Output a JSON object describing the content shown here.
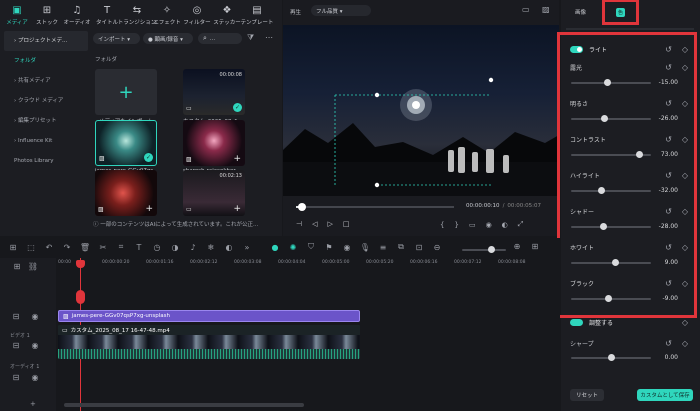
{
  "toolbar": {
    "items": [
      {
        "label": "メディア",
        "icon": "media-icon",
        "glyph": "▣"
      },
      {
        "label": "ストック",
        "icon": "stock-icon",
        "glyph": "⊞"
      },
      {
        "label": "オーディオ",
        "icon": "music-icon",
        "glyph": "♫"
      },
      {
        "label": "タイトル",
        "icon": "title-icon",
        "glyph": "T"
      },
      {
        "label": "トランジション",
        "icon": "transition-icon",
        "glyph": "⇆"
      },
      {
        "label": "エフェクト",
        "icon": "effect-icon",
        "glyph": "✧"
      },
      {
        "label": "フィルター",
        "icon": "filter-icon",
        "glyph": "◎"
      },
      {
        "label": "ステッカー",
        "icon": "sticker-icon",
        "glyph": "❖"
      },
      {
        "label": "テンプレート",
        "icon": "template-icon",
        "glyph": "▤"
      }
    ]
  },
  "sidebar": {
    "items": [
      {
        "label": "› プロジェクトメデ..."
      },
      {
        "label": "フォルダ"
      },
      {
        "label": "› 共有メディア"
      },
      {
        "label": "› クラウド メディア"
      },
      {
        "label": "› 編集プリセット"
      },
      {
        "label": "› Influence Kit"
      },
      {
        "label": "Photos Library"
      }
    ]
  },
  "media": {
    "import_label": "インポート ▾",
    "filter_label": "● 顕画/録音 ▾",
    "search_placeholder": "...",
    "folder_label": "フォルダ",
    "import_tile_label": "メディアをインポート",
    "items": [
      {
        "name": "カスタム_2025_08_1...",
        "duration": "00:00:08"
      },
      {
        "name": "james-pere-GGv07qs...",
        "duration": ""
      },
      {
        "name": "sharosh-rajasekher-...",
        "duration": ""
      },
      {
        "name": "",
        "duration": ""
      },
      {
        "name": "",
        "duration": "00:02:13"
      }
    ],
    "notice": "ⓘ 一部のコンテンツはAIによって生成されています。これが公正..."
  },
  "player": {
    "play_label": "再生",
    "quality_label": "フル品質 ▾",
    "time_current": "00:00:00:10",
    "time_total": "00:00:05:07",
    "progress": 0.04
  },
  "right_panel": {
    "tab_image": "画像",
    "tab_color": "色",
    "light_label": "ライト",
    "adjustments": [
      {
        "label": "露光",
        "value": "-15.00",
        "pos": 0.46
      },
      {
        "label": "明るさ",
        "value": "-26.00",
        "pos": 0.42
      },
      {
        "label": "コントラスト",
        "value": "73.00",
        "pos": 0.85
      },
      {
        "label": "ハイライト",
        "value": "-32.00",
        "pos": 0.38
      },
      {
        "label": "シャドー",
        "value": "-28.00",
        "pos": 0.4
      },
      {
        "label": "ホワイト",
        "value": "9.00",
        "pos": 0.55
      },
      {
        "label": "ブラック",
        "value": "-9.00",
        "pos": 0.47
      }
    ],
    "adjust_label": "調整する",
    "sharpen_label": "シャープ",
    "sharpen_value": "0.00",
    "reset_label": "リセット",
    "save_label": "カスタムとして保存"
  },
  "timeline": {
    "ticks": [
      "00:00",
      "00:00:00:20",
      "00:00:01:16",
      "00:00:02:12",
      "00:00:03:08",
      "00:00:04:04",
      "00:00:05:00",
      "00:00:05:20",
      "00:00:06:16",
      "00:00:07:12",
      "00:00:08:08"
    ],
    "image_clip": "james-pere-GGv07qsP7xg-unsplash",
    "video_clip": "カスタム_2025_08_17 16-47-48.mp4",
    "video_track_label": "ビデオ 1",
    "audio_track_label": "オーディオ 1"
  },
  "colors": {
    "accent": "#2fd6bd",
    "highlight": "#e0353b",
    "clip_purple": "#6b54c9"
  }
}
